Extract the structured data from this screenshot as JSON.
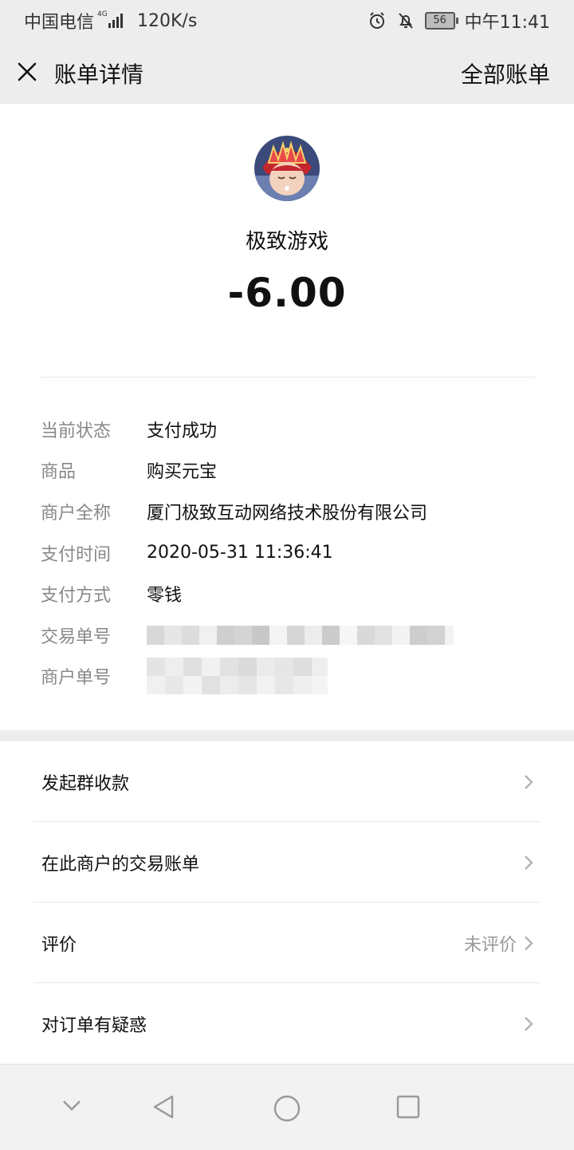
{
  "status_bar": {
    "carrier": "中国电信",
    "network_tag": "4G",
    "speed": "120K/s",
    "battery": "56",
    "time": "中午11:41"
  },
  "nav": {
    "title": "账单详情",
    "right_action": "全部账单"
  },
  "bill": {
    "merchant_name": "极致游戏",
    "amount": "-6.00",
    "rows": [
      {
        "label": "当前状态",
        "value": "支付成功"
      },
      {
        "label": "商品",
        "value": "购买元宝"
      },
      {
        "label": "商户全称",
        "value": "厦门极致互动网络技术股份有限公司"
      },
      {
        "label": "支付时间",
        "value": "2020-05-31 11:36:41"
      },
      {
        "label": "支付方式",
        "value": "零钱"
      },
      {
        "label": "交易单号",
        "value": ""
      },
      {
        "label": "商户单号",
        "value": ""
      }
    ]
  },
  "actions": [
    {
      "label": "发起群收款",
      "status": ""
    },
    {
      "label": "在此商户的交易账单",
      "status": ""
    },
    {
      "label": "评价",
      "status": "未评价"
    },
    {
      "label": "对订单有疑惑",
      "status": ""
    }
  ],
  "icons": {
    "close": "close-icon",
    "chevron": "chevron-right-icon",
    "alarm": "alarm-icon",
    "mute": "bell-off-icon",
    "nav_down": "chevron-down-icon",
    "nav_back": "back-triangle-icon",
    "nav_home": "home-circle-icon",
    "nav_recent": "recent-square-icon"
  },
  "colors": {
    "page_bg": "#ededed",
    "card_bg": "#ffffff",
    "label": "#888888",
    "text": "#111111"
  }
}
